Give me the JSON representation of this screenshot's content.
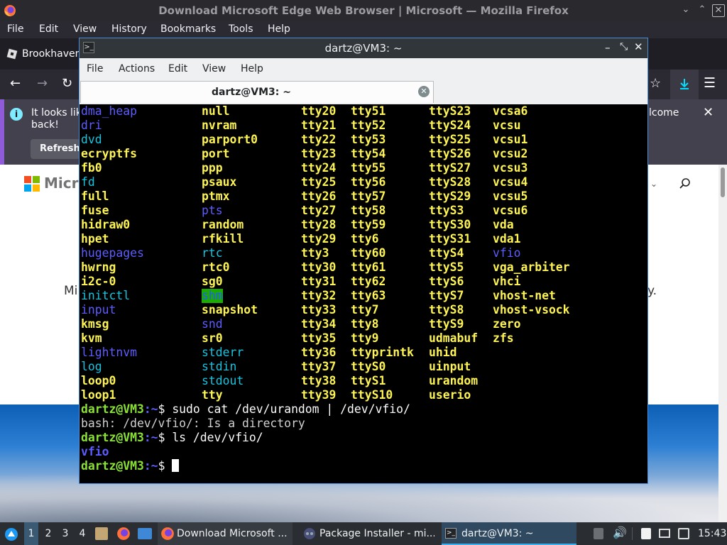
{
  "firefox": {
    "window_title": "Download Microsoft Edge Web Browser | Microsoft — Mozilla Firefox",
    "menu": [
      "File",
      "Edit",
      "View",
      "History",
      "Bookmarks",
      "Tools",
      "Help"
    ],
    "tab_label": "Brookhaven",
    "notice_text_line1": "It looks lik",
    "notice_text_line2": "back!",
    "notice_tail": "lcome",
    "refresh_label": "Refresh",
    "page_logo_text": "Micro",
    "page_text_left": "Mi",
    "page_text_right": "y.",
    "accent_color": "#8f5bd9"
  },
  "terminal": {
    "title": "dartz@VM3: ~",
    "menu": [
      "File",
      "Actions",
      "Edit",
      "View",
      "Help"
    ],
    "tab_label": "dartz@VM3: ~",
    "ls_rows": [
      [
        [
          "dma_heap",
          "dir"
        ],
        [
          "null",
          "dev"
        ],
        [
          "tty20",
          "dev"
        ],
        [
          "tty51",
          "dev"
        ],
        [
          "ttyS23",
          "dev"
        ],
        [
          "vcsa6",
          "dev"
        ]
      ],
      [
        [
          "dri",
          "dir"
        ],
        [
          "nvram",
          "dev"
        ],
        [
          "tty21",
          "dev"
        ],
        [
          "tty52",
          "dev"
        ],
        [
          "ttyS24",
          "dev"
        ],
        [
          "vcsu",
          "dev"
        ]
      ],
      [
        [
          "dvd",
          "link"
        ],
        [
          "parport0",
          "dev"
        ],
        [
          "tty22",
          "dev"
        ],
        [
          "tty53",
          "dev"
        ],
        [
          "ttyS25",
          "dev"
        ],
        [
          "vcsu1",
          "dev"
        ]
      ],
      [
        [
          "ecryptfs",
          "dev"
        ],
        [
          "port",
          "dev"
        ],
        [
          "tty23",
          "dev"
        ],
        [
          "tty54",
          "dev"
        ],
        [
          "ttyS26",
          "dev"
        ],
        [
          "vcsu2",
          "dev"
        ]
      ],
      [
        [
          "fb0",
          "dev"
        ],
        [
          "ppp",
          "dev"
        ],
        [
          "tty24",
          "dev"
        ],
        [
          "tty55",
          "dev"
        ],
        [
          "ttyS27",
          "dev"
        ],
        [
          "vcsu3",
          "dev"
        ]
      ],
      [
        [
          "fd",
          "link"
        ],
        [
          "psaux",
          "dev"
        ],
        [
          "tty25",
          "dev"
        ],
        [
          "tty56",
          "dev"
        ],
        [
          "ttyS28",
          "dev"
        ],
        [
          "vcsu4",
          "dev"
        ]
      ],
      [
        [
          "full",
          "dev"
        ],
        [
          "ptmx",
          "dev"
        ],
        [
          "tty26",
          "dev"
        ],
        [
          "tty57",
          "dev"
        ],
        [
          "ttyS29",
          "dev"
        ],
        [
          "vcsu5",
          "dev"
        ]
      ],
      [
        [
          "fuse",
          "dev"
        ],
        [
          "pts",
          "dir"
        ],
        [
          "tty27",
          "dev"
        ],
        [
          "tty58",
          "dev"
        ],
        [
          "ttyS3",
          "dev"
        ],
        [
          "vcsu6",
          "dev"
        ]
      ],
      [
        [
          "hidraw0",
          "dev"
        ],
        [
          "random",
          "dev"
        ],
        [
          "tty28",
          "dev"
        ],
        [
          "tty59",
          "dev"
        ],
        [
          "ttyS30",
          "dev"
        ],
        [
          "vda",
          "dev"
        ]
      ],
      [
        [
          "hpet",
          "dev"
        ],
        [
          "rfkill",
          "dev"
        ],
        [
          "tty29",
          "dev"
        ],
        [
          "tty6",
          "dev"
        ],
        [
          "ttyS31",
          "dev"
        ],
        [
          "vda1",
          "dev"
        ]
      ],
      [
        [
          "hugepages",
          "dir"
        ],
        [
          "rtc",
          "link"
        ],
        [
          "tty3",
          "dev"
        ],
        [
          "tty60",
          "dev"
        ],
        [
          "ttyS4",
          "dev"
        ],
        [
          "vfio",
          "dir"
        ]
      ],
      [
        [
          "hwrng",
          "dev"
        ],
        [
          "rtc0",
          "dev"
        ],
        [
          "tty30",
          "dev"
        ],
        [
          "tty61",
          "dev"
        ],
        [
          "ttyS5",
          "dev"
        ],
        [
          "vga_arbiter",
          "dev"
        ]
      ],
      [
        [
          "i2c-0",
          "dev"
        ],
        [
          "sg0",
          "dev"
        ],
        [
          "tty31",
          "dev"
        ],
        [
          "tty62",
          "dev"
        ],
        [
          "ttyS6",
          "dev"
        ],
        [
          "vhci",
          "dev"
        ]
      ],
      [
        [
          "initctl",
          "link"
        ],
        [
          "shm",
          "hl"
        ],
        [
          "tty32",
          "dev"
        ],
        [
          "tty63",
          "dev"
        ],
        [
          "ttyS7",
          "dev"
        ],
        [
          "vhost-net",
          "dev"
        ]
      ],
      [
        [
          "input",
          "dir"
        ],
        [
          "snapshot",
          "dev"
        ],
        [
          "tty33",
          "dev"
        ],
        [
          "tty7",
          "dev"
        ],
        [
          "ttyS8",
          "dev"
        ],
        [
          "vhost-vsock",
          "dev"
        ]
      ],
      [
        [
          "kmsg",
          "dev"
        ],
        [
          "snd",
          "dir"
        ],
        [
          "tty34",
          "dev"
        ],
        [
          "tty8",
          "dev"
        ],
        [
          "ttyS9",
          "dev"
        ],
        [
          "zero",
          "dev"
        ]
      ],
      [
        [
          "kvm",
          "dev"
        ],
        [
          "sr0",
          "dev"
        ],
        [
          "tty35",
          "dev"
        ],
        [
          "tty9",
          "dev"
        ],
        [
          "udmabuf",
          "dev"
        ],
        [
          "zfs",
          "dev"
        ]
      ],
      [
        [
          "lightnvm",
          "dir"
        ],
        [
          "stderr",
          "link"
        ],
        [
          "tty36",
          "dev"
        ],
        [
          "ttyprintk",
          "dev"
        ],
        [
          "uhid",
          "dev"
        ]
      ],
      [
        [
          "log",
          "link"
        ],
        [
          "stdin",
          "link"
        ],
        [
          "tty37",
          "dev"
        ],
        [
          "ttyS0",
          "dev"
        ],
        [
          "uinput",
          "dev"
        ]
      ],
      [
        [
          "loop0",
          "dev"
        ],
        [
          "stdout",
          "link"
        ],
        [
          "tty38",
          "dev"
        ],
        [
          "ttyS1",
          "dev"
        ],
        [
          "urandom",
          "dev"
        ]
      ],
      [
        [
          "loop1",
          "dev"
        ],
        [
          "tty",
          "dev"
        ],
        [
          "tty39",
          "dev"
        ],
        [
          "ttyS10",
          "dev"
        ],
        [
          "userio",
          "dev"
        ]
      ]
    ],
    "prompt_user": "dartz@VM3",
    "prompt_dir": ":~",
    "prompt_sym": "$ ",
    "cmd1": "sudo cat /dev/urandom | /dev/vfio/",
    "out1": "bash: /dev/vfio/: Is a directory",
    "cmd2": "ls /dev/vfio/",
    "out2": "vfio",
    "colors": {
      "dir": "#5c5cff",
      "dev": "#fdf453",
      "link": "#16c4e0",
      "prompt": "#8ae234",
      "highlight_bg": "#1cab00"
    }
  },
  "taskbar": {
    "workspaces": [
      "1",
      "2",
      "3",
      "4"
    ],
    "tasks": [
      "Download Microsoft ...",
      "Package Installer - mi...",
      "dartz@VM3: ~"
    ],
    "clock": "15:43"
  }
}
